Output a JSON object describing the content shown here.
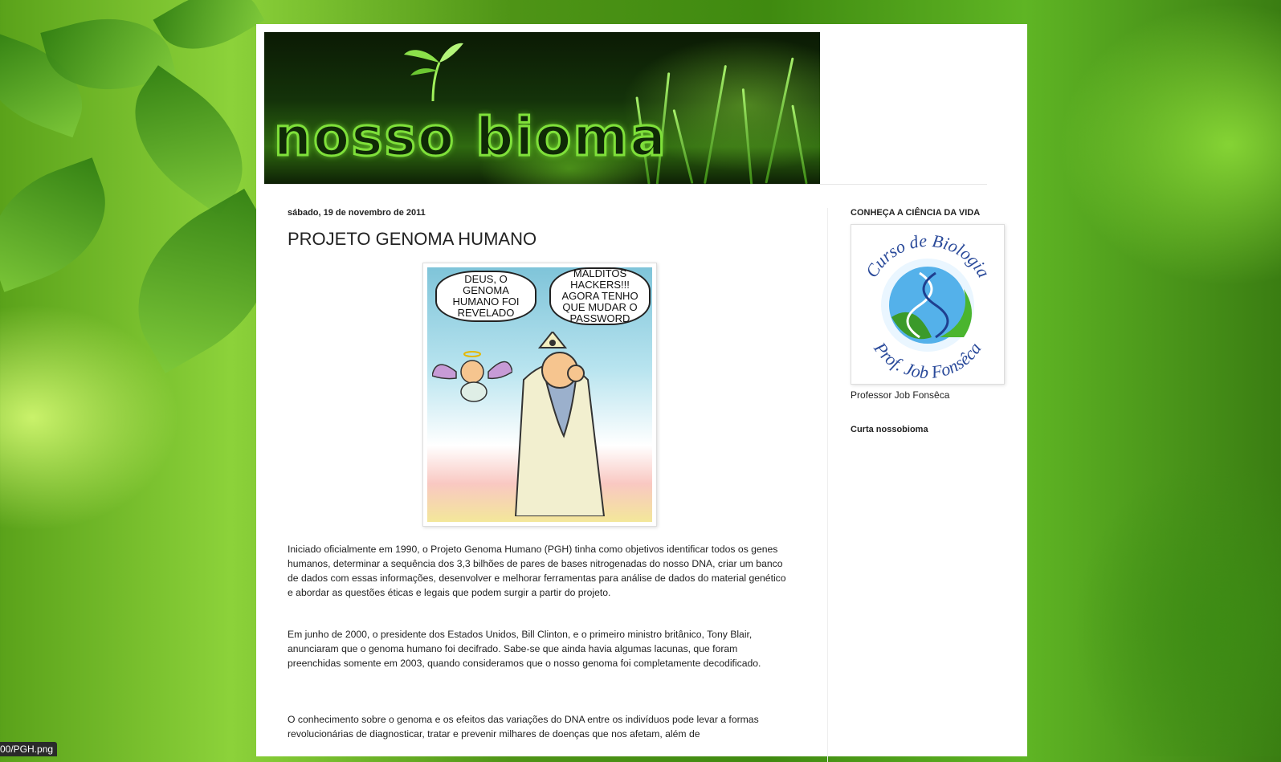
{
  "banner": {
    "title": "nosso bioma"
  },
  "post": {
    "date": "sábado, 19 de novembro de 2011",
    "title": "PROJETO GENOMA HUMANO",
    "comic": {
      "bubble_left": "DEUS, O GENOMA HUMANO FOI REVELADO",
      "bubble_right": "MALDITOS HACKERS!!! AGORA TENHO QUE MUDAR O PASSWORD"
    },
    "paragraphs": [
      "Iniciado oficialmente em 1990, o Projeto Genoma Humano (PGH) tinha como objetivos identificar todos os genes humanos, determinar a sequência dos 3,3 bilhões de pares de bases nitrogenadas do nosso DNA, criar um banco de dados com essas informações, desenvolver e melhorar ferramentas para análise de dados do material genético e abordar as questões éticas e legais que podem surgir a partir do projeto.",
      "Em junho de 2000, o presidente dos Estados Unidos, Bill Clinton, e o primeiro ministro britânico, Tony Blair, anunciaram que o genoma humano foi decifrado. Sabe-se que ainda havia algumas lacunas, que foram preenchidas somente em 2003, quando consideramos que o nosso genoma foi completamente decodificado.",
      "O conhecimento sobre o genoma e os efeitos das variações do DNA entre os indivíduos pode levar a formas revolucionárias de diagnosticar, tratar e prevenir milhares de doenças que nos afetam, além de"
    ]
  },
  "sidebar": {
    "widget1_title": "CONHEÇA A CIÊNCIA DA VIDA",
    "logo": {
      "top_text": "Curso de Biologia",
      "bottom_text": "Prof. Job Fonsêca"
    },
    "logo_caption": "Professor Job Fonsêca",
    "widget2_title": "Curta nossobioma"
  },
  "status_bar": {
    "link_text": "00/PGH.png"
  },
  "colors": {
    "accent_green": "#7fe03a",
    "logo_blue": "#2a4a9a",
    "logo_green": "#3b9a2a"
  }
}
